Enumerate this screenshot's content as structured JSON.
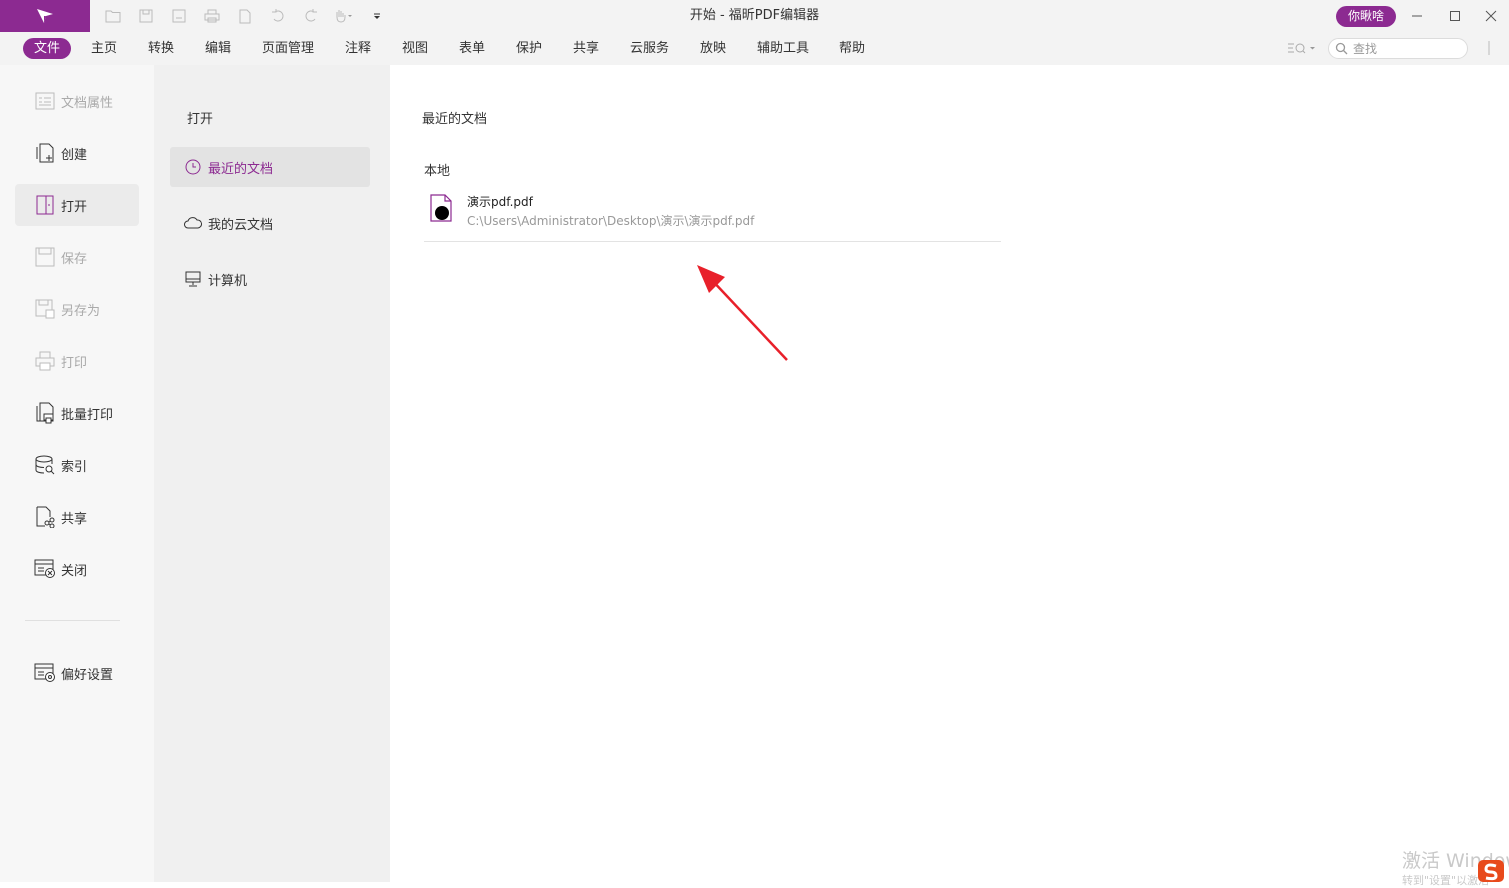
{
  "window": {
    "title": "开始 - 福昕PDF编辑器",
    "user_button": "你瞅啥"
  },
  "menu": [
    {
      "label": "文件"
    },
    {
      "label": "主页"
    },
    {
      "label": "转换"
    },
    {
      "label": "编辑"
    },
    {
      "label": "页面管理"
    },
    {
      "label": "注释"
    },
    {
      "label": "视图"
    },
    {
      "label": "表单"
    },
    {
      "label": "保护"
    },
    {
      "label": "共享"
    },
    {
      "label": "云服务"
    },
    {
      "label": "放映"
    },
    {
      "label": "辅助工具"
    },
    {
      "label": "帮助"
    }
  ],
  "search": {
    "placeholder": "查找"
  },
  "sidebar": {
    "items": [
      {
        "label": "文档属性",
        "icon": "document-properties-icon"
      },
      {
        "label": "创建",
        "icon": "create-icon"
      },
      {
        "label": "打开",
        "icon": "open-icon"
      },
      {
        "label": "保存",
        "icon": "save-icon"
      },
      {
        "label": "另存为",
        "icon": "save-as-icon"
      },
      {
        "label": "打印",
        "icon": "print-icon"
      },
      {
        "label": "批量打印",
        "icon": "batch-print-icon"
      },
      {
        "label": "索引",
        "icon": "index-icon"
      },
      {
        "label": "共享",
        "icon": "share-icon"
      },
      {
        "label": "关闭",
        "icon": "close-document-icon"
      },
      {
        "label": "偏好设置",
        "icon": "preferences-icon"
      }
    ]
  },
  "open_panel": {
    "title": "打开",
    "items": [
      {
        "label": "最近的文档",
        "icon": "clock-icon"
      },
      {
        "label": "我的云文档",
        "icon": "cloud-icon"
      },
      {
        "label": "计算机",
        "icon": "computer-icon"
      }
    ]
  },
  "recent": {
    "title": "最近的文档",
    "section": "本地",
    "files": [
      {
        "name": "演示pdf.pdf",
        "path": "C:\\Users\\Administrator\\Desktop\\演示\\演示pdf.pdf"
      }
    ]
  },
  "watermark": {
    "line1": "激活 Windows",
    "line2": "转到\"设置\"以激活"
  },
  "colors": {
    "accent": "#8c2a91",
    "arrow": "#e8202a"
  }
}
